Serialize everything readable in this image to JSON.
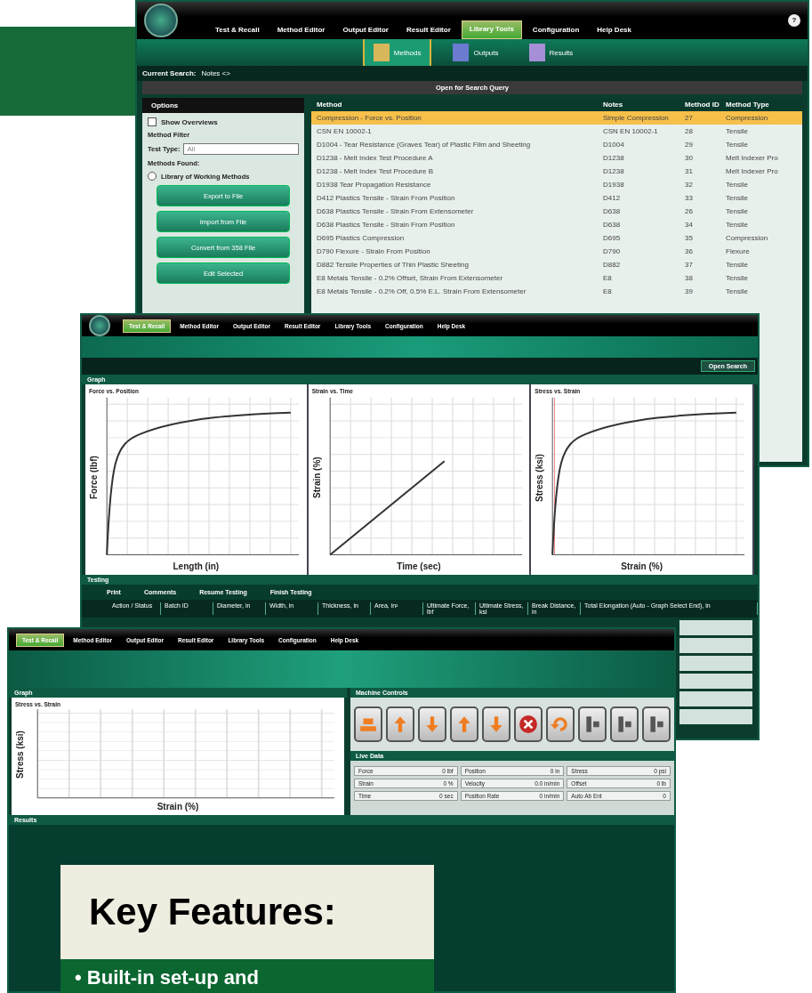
{
  "library_window": {
    "nav_tabs": [
      {
        "label": "Test & Recall",
        "selected": false
      },
      {
        "label": "Method Editor",
        "selected": false
      },
      {
        "label": "Output Editor",
        "selected": false
      },
      {
        "label": "Result Editor",
        "selected": false
      },
      {
        "label": "Library Tools",
        "selected": true
      },
      {
        "label": "Configuration",
        "selected": false
      },
      {
        "label": "Help Desk",
        "selected": false
      }
    ],
    "help": "?",
    "sub_tabs": [
      {
        "label": "Methods",
        "selected": true
      },
      {
        "label": "Outputs",
        "selected": false
      },
      {
        "label": "Results",
        "selected": false
      }
    ],
    "current_search": {
      "label": "Current Search:",
      "value": "Notes <>"
    },
    "query_bar": "Open for Search Query",
    "options": {
      "title": "Options",
      "show_overviews": {
        "label": "Show Overviews",
        "checked": false
      },
      "filter_title": "Method Filter",
      "test_type": {
        "label": "Test Type:",
        "value": "All"
      },
      "methods_found": "Methods Found:",
      "library": {
        "label": "Library of Working Methods",
        "selected": false
      },
      "buttons": [
        "Export to File",
        "Import from File",
        "Convert from 358 File",
        "Edit Selected"
      ]
    },
    "table": {
      "columns": [
        "Method",
        "Notes",
        "Method ID",
        "Method Type"
      ],
      "rows": [
        {
          "cells": [
            "Compression - Force vs. Position",
            "Simple Compression",
            "27",
            "Compression"
          ],
          "selected": true
        },
        {
          "cells": [
            "CSN EN 10002-1",
            "CSN EN 10002-1",
            "28",
            "Tensile"
          ],
          "selected": false
        },
        {
          "cells": [
            "D1004 - Tear Resistance (Graves Tear) of Plastic Film and Sheeting",
            "D1004",
            "29",
            "Tensile"
          ],
          "selected": false
        },
        {
          "cells": [
            "D1238 - Melt Index Test Procedure A",
            "D1238",
            "30",
            "Melt Indexer Pro"
          ],
          "selected": false
        },
        {
          "cells": [
            "D1238 - Melt Index Test Procedure B",
            "D1238",
            "31",
            "Melt Indexer Pro"
          ],
          "selected": false
        },
        {
          "cells": [
            "D1938 Tear Propagation Resistance",
            "D1938",
            "32",
            "Tensile"
          ],
          "selected": false
        },
        {
          "cells": [
            "D412 Plastics Tensile - Strain From Position",
            "D412",
            "33",
            "Tensile"
          ],
          "selected": false
        },
        {
          "cells": [
            "D638 Plastics Tensile - Strain From Extensometer",
            "D638",
            "26",
            "Tensile"
          ],
          "selected": false
        },
        {
          "cells": [
            "D638 Plastics Tensile - Strain From Position",
            "D638",
            "34",
            "Tensile"
          ],
          "selected": false
        },
        {
          "cells": [
            "D695 Plastics Compression",
            "D695",
            "35",
            "Compression"
          ],
          "selected": false
        },
        {
          "cells": [
            "D790 Flexure - Strain From Position",
            "D790",
            "36",
            "Flexure"
          ],
          "selected": false
        },
        {
          "cells": [
            "D882 Tensile Properties of Thin Plastic Sheeting",
            "D882",
            "37",
            "Tensile"
          ],
          "selected": false
        },
        {
          "cells": [
            "E8 Metals Tensile - 0.2% Offset, Strain From Extensometer",
            "E8",
            "38",
            "Tensile"
          ],
          "selected": false
        },
        {
          "cells": [
            "E8 Metals Tensile - 0.2% Off, 0.5% E.L. Strain From Extensometer",
            "E8",
            "39",
            "Tensile"
          ],
          "selected": false
        }
      ]
    }
  },
  "test_window": {
    "nav_tabs": [
      {
        "label": "Test & Recall",
        "selected": true
      },
      {
        "label": "Method Editor",
        "selected": false
      },
      {
        "label": "Output Editor",
        "selected": false
      },
      {
        "label": "Result Editor",
        "selected": false
      },
      {
        "label": "Library Tools",
        "selected": false
      },
      {
        "label": "Configuration",
        "selected": false
      },
      {
        "label": "Help Desk",
        "selected": false
      }
    ],
    "toolbar": [
      "Open Search"
    ],
    "graph_title": "Graph",
    "charts": [
      {
        "title": "Force vs. Position",
        "xlabel": "Length (in)",
        "ylabel": "Force (lbf)",
        "kind": "plateau"
      },
      {
        "title": "Strain vs. Time",
        "xlabel": "Time (sec)",
        "ylabel": "Strain (%)",
        "kind": "linear"
      },
      {
        "title": "Stress vs. Strain",
        "xlabel": "Strain (%)",
        "ylabel": "Stress (ksi)",
        "kind": "plateau"
      }
    ],
    "testing": {
      "title": "Testing",
      "toolbar": [
        "Print",
        "Comments",
        "Resume Testing",
        "Finish Testing"
      ],
      "columns": [
        "Action / Status",
        "Batch ID",
        "Diameter, in",
        "Width, in",
        "Thickness, in",
        "Area, in²",
        "Ultimate Force, lbf",
        "Ultimate Stress, ksi",
        "Break Distance, in",
        "Total Elongation (Auto - Graph Select End), in"
      ]
    }
  },
  "live_window": {
    "nav_tabs": [
      {
        "label": "Test & Recall",
        "selected": true
      },
      {
        "label": "Method Editor",
        "selected": false
      },
      {
        "label": "Output Editor",
        "selected": false
      },
      {
        "label": "Result Editor",
        "selected": false
      },
      {
        "label": "Library Tools",
        "selected": false
      },
      {
        "label": "Configuration",
        "selected": false
      },
      {
        "label": "Help Desk",
        "selected": false
      }
    ],
    "graph": {
      "title": "Graph",
      "chart": {
        "title": "Stress vs. Strain",
        "xlabel": "Strain (%)",
        "ylabel": "Stress (ksi)"
      }
    },
    "machine_controls": {
      "title": "Machine Controls",
      "buttons": [
        {
          "kind": "load"
        },
        {
          "kind": "up"
        },
        {
          "kind": "down"
        },
        {
          "kind": "up"
        },
        {
          "kind": "down"
        },
        {
          "kind": "stop"
        },
        {
          "kind": "return"
        },
        {
          "kind": "grip"
        },
        {
          "kind": "grip"
        },
        {
          "kind": "grip"
        }
      ]
    },
    "live_data": {
      "title": "Live Data",
      "readings": [
        {
          "label": "Force",
          "value": "0 lbf"
        },
        {
          "label": "Position",
          "value": "0 in"
        },
        {
          "label": "Stress",
          "value": "0 psi"
        },
        {
          "label": "Strain",
          "value": "0 %"
        },
        {
          "label": "Velocity",
          "value": "0.0 in/min"
        },
        {
          "label": "Offset",
          "value": "0 lb"
        },
        {
          "label": "Time",
          "value": "0 sec"
        },
        {
          "label": "Position Rate",
          "value": "0 in/min"
        },
        {
          "label": "Auto Ab Ent",
          "value": "0"
        }
      ]
    },
    "results": {
      "title": "Results"
    }
  },
  "key_features": {
    "title": "Key Features:",
    "items": [
      "• Built-in set-up and"
    ]
  }
}
